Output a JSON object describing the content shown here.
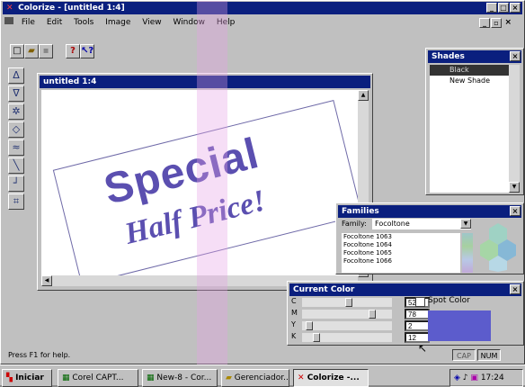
{
  "app": {
    "title": "Colorize - [untitled 1:4]"
  },
  "menu": [
    "File",
    "Edit",
    "Tools",
    "Image",
    "View",
    "Window",
    "Help"
  ],
  "doc": {
    "title": "untitled 1:4"
  },
  "canvas": {
    "line1": "Special",
    "line2": "Half Price!"
  },
  "shades": {
    "title": "Shades",
    "items": [
      "Black",
      "New Shade"
    ]
  },
  "families": {
    "title": "Families",
    "family_label": "Family:",
    "family_value": "Focoltone",
    "list": [
      "Focoltone 1063",
      "Focoltone 1064",
      "Focoltone 1065",
      "Focoltone 1066"
    ]
  },
  "current_color": {
    "title": "Current Color",
    "rows": [
      {
        "label": "C",
        "value": "52"
      },
      {
        "label": "M",
        "value": "78"
      },
      {
        "label": "Y",
        "value": "2"
      },
      {
        "label": "K",
        "value": "12"
      }
    ],
    "spot_label": "Spot Color",
    "swatch": "#5c5ccc"
  },
  "status": {
    "help": "Press F1 for help.",
    "cap": "CAP",
    "num": "NUM"
  },
  "taskbar": {
    "start": "Iniciar",
    "items": [
      "Corel CAPT...",
      "New-8 - Cor...",
      "Gerenciador...",
      "Colorize -..."
    ],
    "clock": "17:24"
  },
  "colors": {
    "title_bar": "#0a1f7e",
    "text_purple": "#5b4fb0",
    "swatch": "#5c5ccc"
  }
}
